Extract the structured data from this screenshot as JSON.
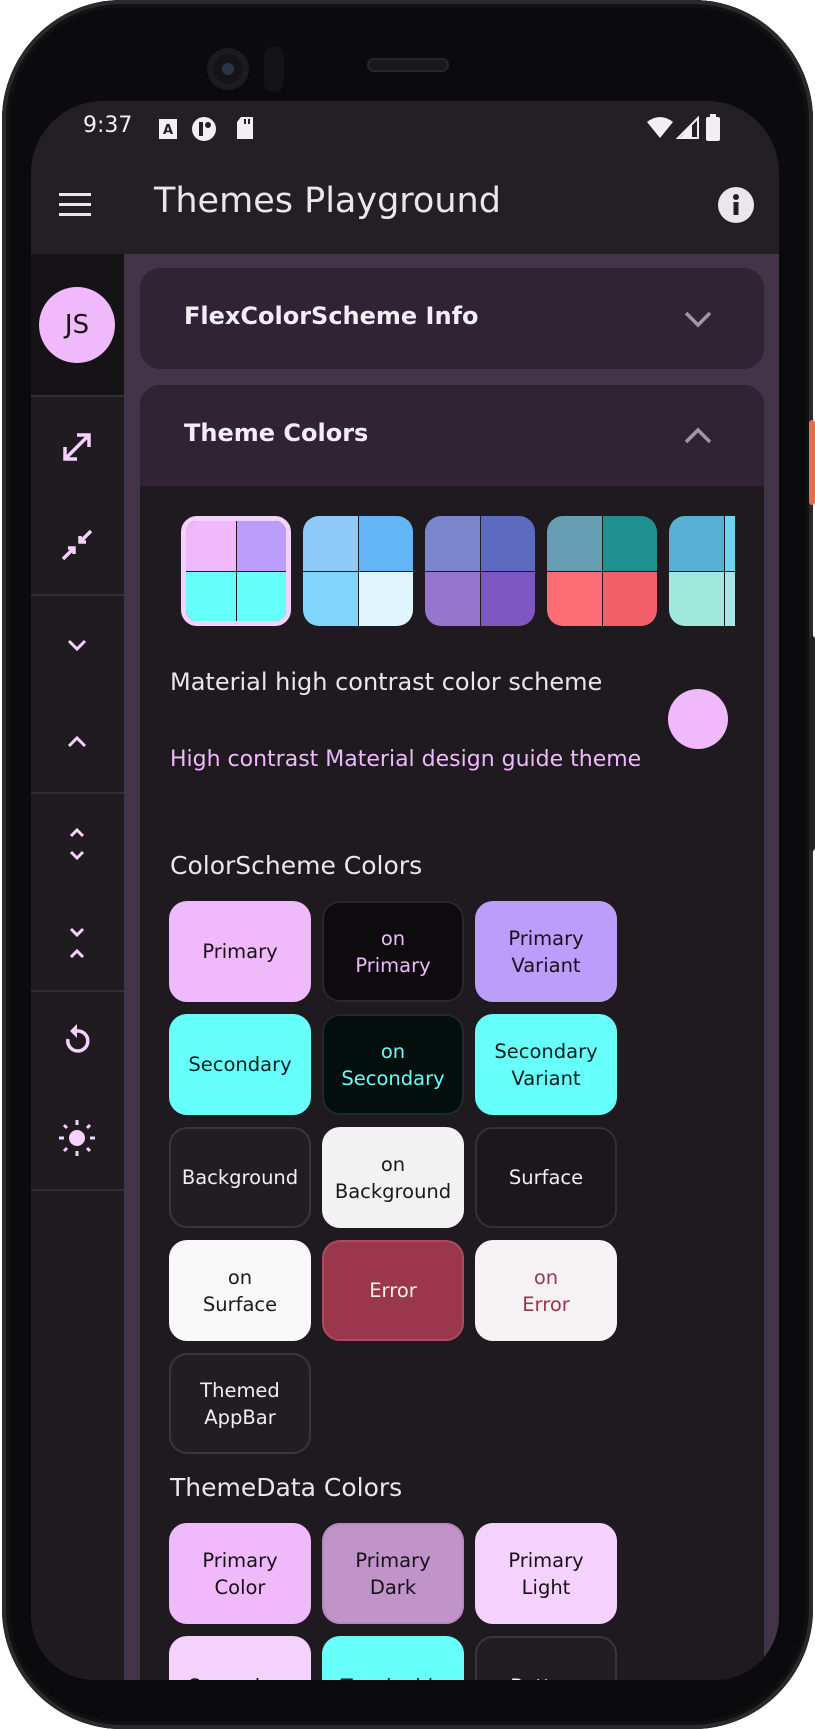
{
  "status_bar": {
    "time": "9:37",
    "icons": [
      "a-icon",
      "circle-notification-icon",
      "sd-card-icon",
      "wifi-icon",
      "signal-icon",
      "battery-icon"
    ]
  },
  "app_bar": {
    "title": "Themes Playground",
    "menu_icon": "menu-icon",
    "info_icon": "info-icon"
  },
  "rail": {
    "avatar_initials": "JS",
    "items": [
      "expand-icon",
      "collapse-icon",
      "chevron-down-icon",
      "chevron-up-icon",
      "unfold-more-icon",
      "unfold-less-icon",
      "reset-icon",
      "brightness-icon"
    ]
  },
  "cards": {
    "info": {
      "title": "FlexColorScheme Info",
      "expanded": false
    },
    "theme_colors": {
      "title": "Theme Colors",
      "expanded": true
    }
  },
  "swatches": [
    {
      "selected": true,
      "colors": [
        "#EFB9FC",
        "#BB9EFB",
        "#66FFF9",
        "#66FFF9"
      ]
    },
    {
      "selected": false,
      "colors": [
        "#90CAF9",
        "#64B5F6",
        "#81D4FA",
        "#E1F5FE"
      ]
    },
    {
      "selected": false,
      "colors": [
        "#7986CB",
        "#5C6BC0",
        "#9575CD",
        "#7E57C2"
      ]
    },
    {
      "selected": false,
      "colors": [
        "#669EB3",
        "#1F9090",
        "#FD6D76",
        "#F45E68"
      ]
    },
    {
      "selected": false,
      "colors": [
        "#59B0D6",
        "#6DD6EF",
        "#9EE8DC",
        "#A6E6E6"
      ]
    }
  ],
  "scheme_switch": {
    "title": "Material high contrast color scheme",
    "subtitle": "High contrast Material design guide theme",
    "on": true
  },
  "colorscheme": {
    "title": "ColorScheme Colors",
    "boxes": [
      {
        "label": "Primary",
        "bg": "#EFB9FC",
        "fg": "#1a1018",
        "border": "#EFB9FC"
      },
      {
        "label": "on\nPrimary",
        "bg": "#0D0B0E",
        "fg": "#EFB9FC",
        "border": "#2a262c"
      },
      {
        "label": "Primary\nVariant",
        "bg": "#BB9EFB",
        "fg": "#1a1018",
        "border": "#BB9EFB"
      },
      {
        "label": "Secondary",
        "bg": "#66FFF9",
        "fg": "#05201f",
        "border": "#66FFF9"
      },
      {
        "label": "on\nSecondary",
        "bg": "#030E0D",
        "fg": "#66FFF9",
        "border": "#1f2a2a"
      },
      {
        "label": "Secondary\nVariant",
        "bg": "#66FFF9",
        "fg": "#05201f",
        "border": "#66FFF9"
      },
      {
        "label": "Background",
        "bg": "#221D23",
        "fg": "#f1eef2",
        "border": "#3a353c"
      },
      {
        "label": "on\nBackground",
        "bg": "#F2F2F2",
        "fg": "#1a1a1a",
        "border": "#F2F2F2"
      },
      {
        "label": "Surface",
        "bg": "#1B181C",
        "fg": "#f1eef2",
        "border": "#353037"
      },
      {
        "label": "on\nSurface",
        "bg": "#F8F8F8",
        "fg": "#1a1a1a",
        "border": "#F8F8F8"
      },
      {
        "label": "Error",
        "bg": "#9B374D",
        "fg": "#f8eef0",
        "border": "#b0485e"
      },
      {
        "label": "on\nError",
        "bg": "#F6F1F3",
        "fg": "#9B374D",
        "border": "#F6F1F3"
      },
      {
        "label": "Themed\nAppBar",
        "bg": "#221D23",
        "fg": "#f1eef2",
        "border": "#3a353c"
      }
    ]
  },
  "themedata": {
    "title": "ThemeData Colors",
    "boxes": [
      {
        "label": "Primary\nColor",
        "bg": "#EFB9FC",
        "fg": "#1a1018",
        "border": "#EFB9FC"
      },
      {
        "label": "Primary\nDark",
        "bg": "#C093C9",
        "fg": "#1a1018",
        "border": "#b588bf"
      },
      {
        "label": "Primary\nLight",
        "bg": "#F5D2FD",
        "fg": "#1a1018",
        "border": "#F5D2FD"
      },
      {
        "label": "Secondary",
        "bg": "#F5D2FD",
        "fg": "#1a1018",
        "border": "#F5D2FD"
      },
      {
        "label": "Toggleable",
        "bg": "#66FFF9",
        "fg": "#05201f",
        "border": "#66FFF9"
      },
      {
        "label": "Bottom",
        "bg": "#221D23",
        "fg": "#f1eef2",
        "border": "#3a353c"
      }
    ]
  }
}
